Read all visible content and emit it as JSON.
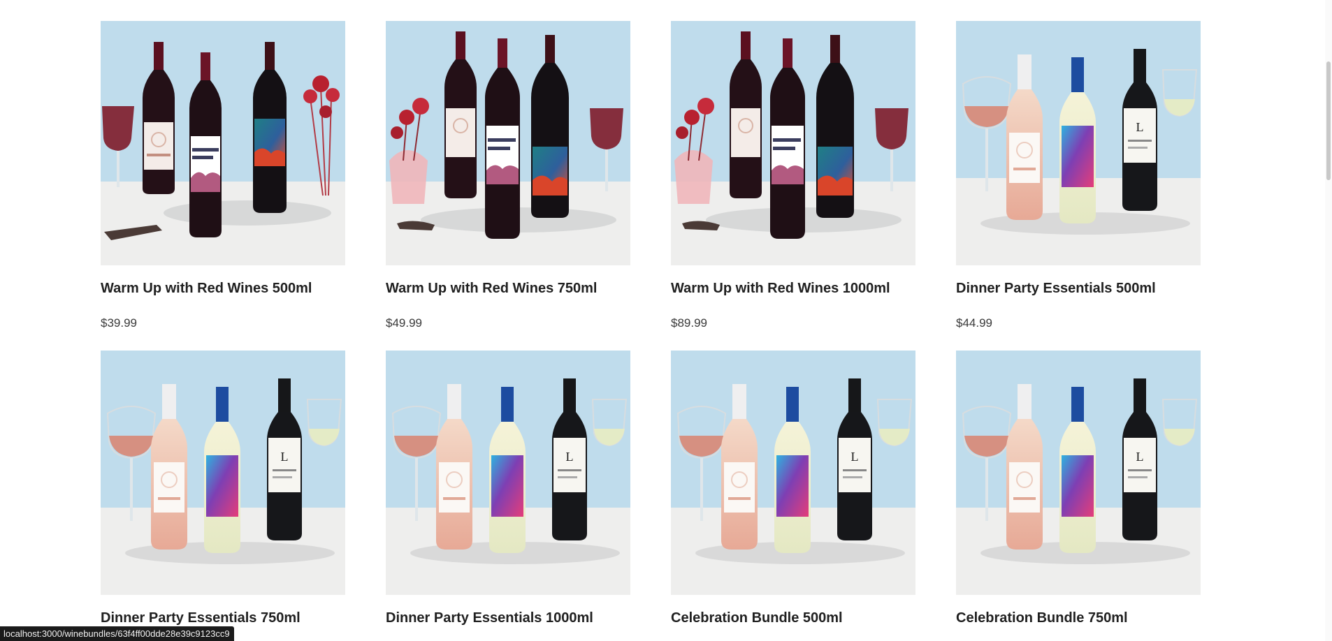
{
  "products": [
    {
      "title": "Warm Up with Red Wines 500ml",
      "price": "$39.99",
      "image": "red-wines-image"
    },
    {
      "title": "Warm Up with Red Wines 750ml",
      "price": "$49.99",
      "image": "red-wines-image"
    },
    {
      "title": "Warm Up with Red Wines 1000ml",
      "price": "$89.99",
      "image": "red-wines-image"
    },
    {
      "title": "Dinner Party Essentials 500ml",
      "price": "$44.99",
      "image": "dinner-party-image"
    },
    {
      "title": "Dinner Party Essentials 750ml",
      "price": "",
      "image": "dinner-party-image"
    },
    {
      "title": "Dinner Party Essentials 1000ml",
      "price": "",
      "image": "dinner-party-image"
    },
    {
      "title": "Celebration Bundle 500ml",
      "price": "",
      "image": "dinner-party-image"
    },
    {
      "title": "Celebration Bundle 750ml",
      "price": "",
      "image": "dinner-party-image"
    }
  ],
  "status_bar": {
    "url": "localhost:3000/winebundles/63f4ff00dde28e39c9123cc9"
  },
  "colors": {
    "sky_background": "#bfdcec",
    "table_surface": "#eeeeed",
    "title_text": "#202020",
    "price_text": "#3a3a3a"
  }
}
